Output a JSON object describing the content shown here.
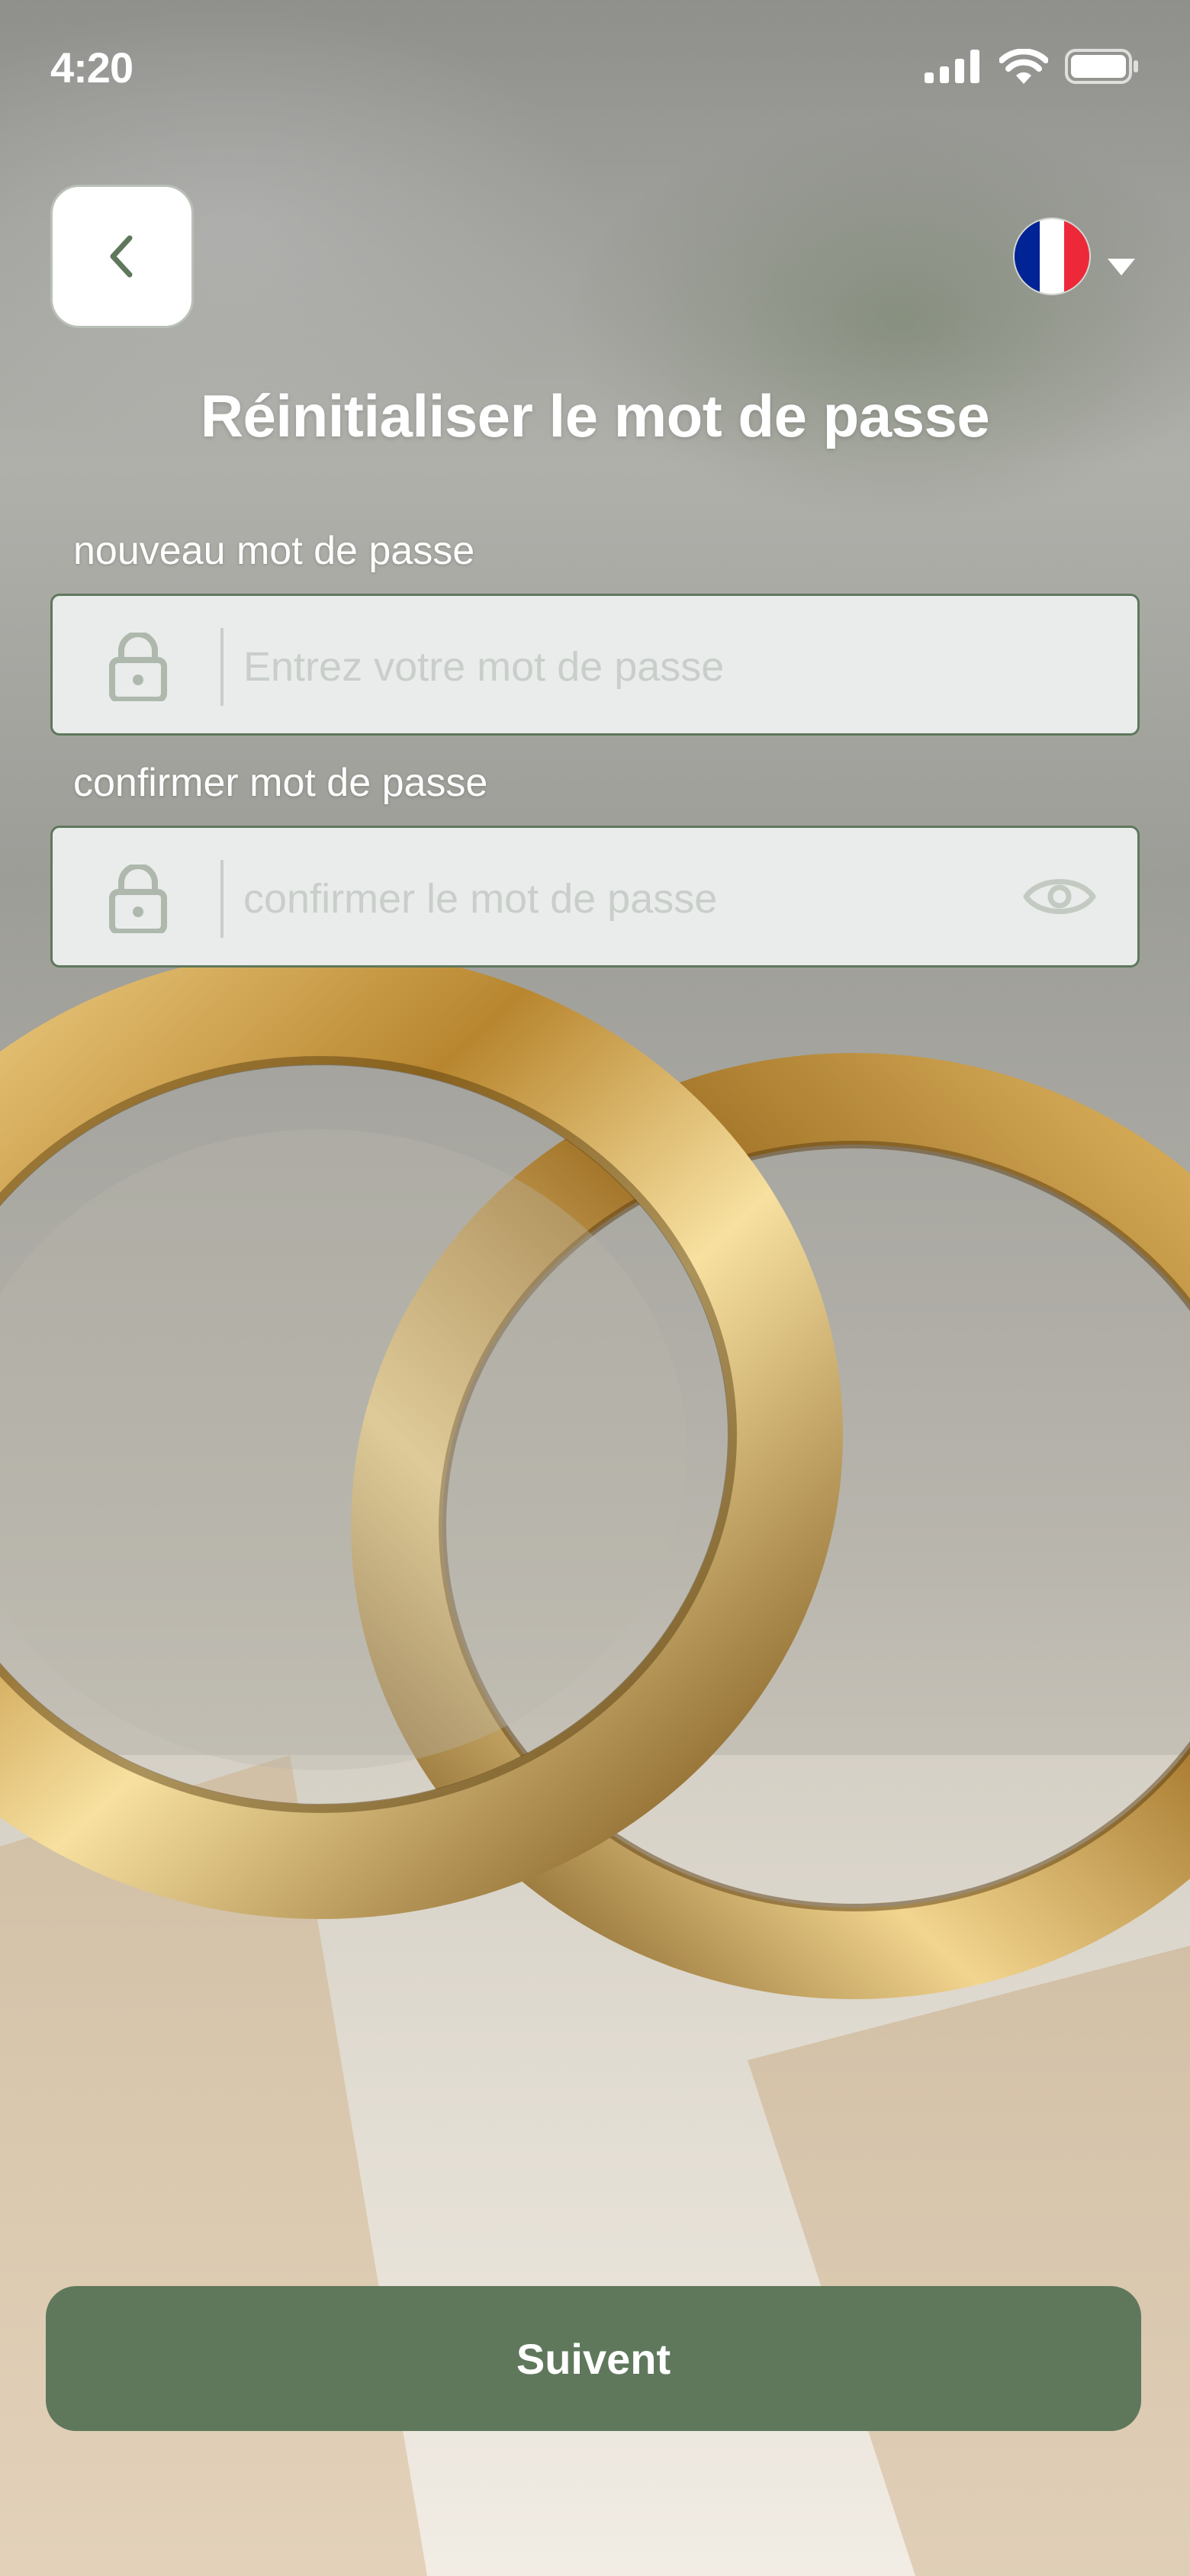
{
  "status_bar": {
    "time": "4:20"
  },
  "header": {
    "back_icon": "chevron-left-icon",
    "language_flag": "france-flag",
    "flag_colors": [
      "#002395",
      "#ffffff",
      "#ed2939"
    ]
  },
  "title": "Réinitialiser le mot de passe",
  "form": {
    "new_password": {
      "label": "nouveau mot de passe",
      "placeholder": "Entrez votre mot de passe",
      "value": ""
    },
    "confirm_password": {
      "label": "confirmer mot de passe",
      "placeholder": "confirmer le mot de passe",
      "value": ""
    }
  },
  "submit_label": "Suivent",
  "colors": {
    "accent": "#5f785c",
    "field_background": "#e9ecea",
    "placeholder": "#c9ceca"
  }
}
